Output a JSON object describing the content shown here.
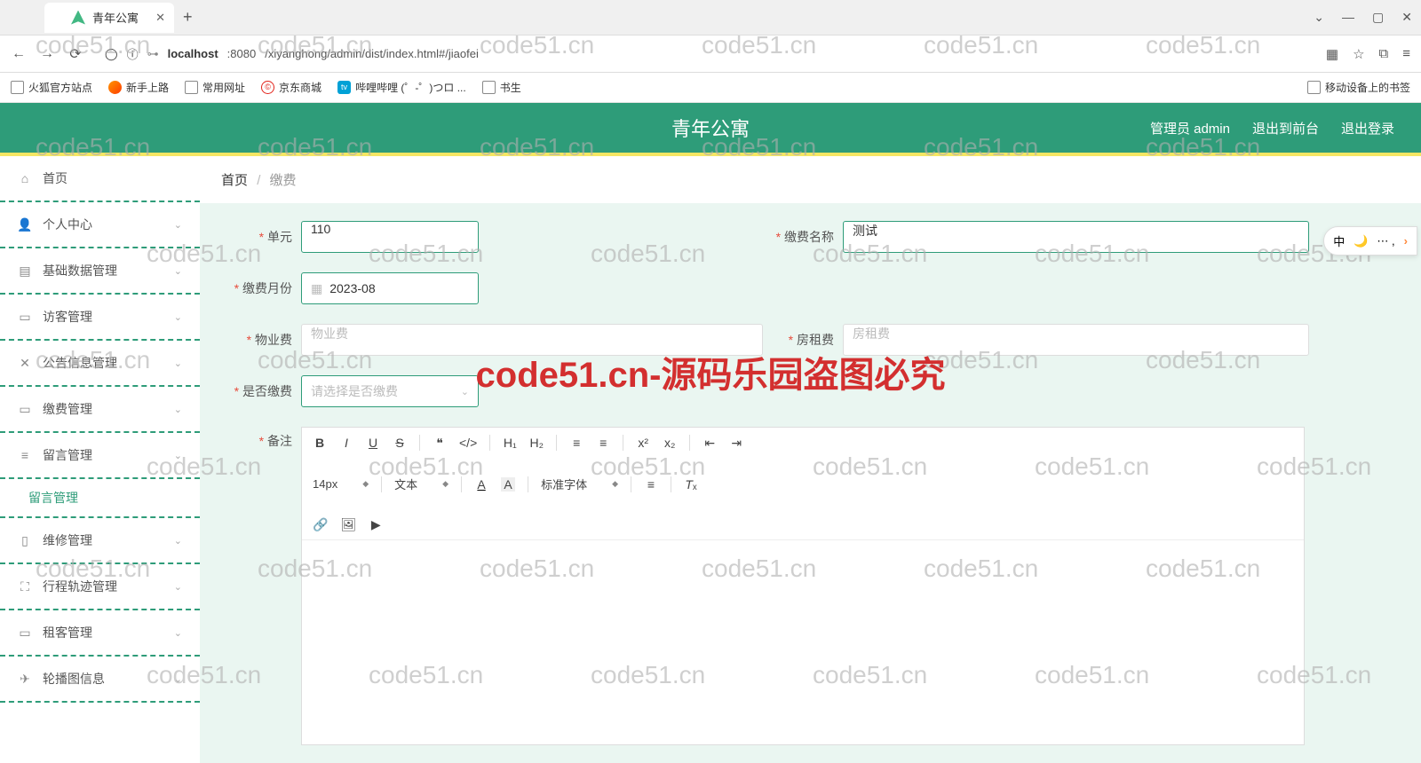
{
  "browser": {
    "tab_title": "青年公寓",
    "url_host": "localhost",
    "url_port": ":8080",
    "url_path": "/xiyanghong/admin/dist/index.html#/jiaofei",
    "bookmarks": [
      "火狐官方站点",
      "新手上路",
      "常用网址",
      "京东商城",
      "哔哩哔哩 (゜-゜)つロ ...",
      "书生"
    ],
    "mobile_bm": "移动设备上的书签"
  },
  "header": {
    "title": "青年公寓",
    "admin_label": "管理员 admin",
    "exit_front": "退出到前台",
    "logout": "退出登录"
  },
  "sidebar": {
    "items": [
      "首页",
      "个人中心",
      "基础数据管理",
      "访客管理",
      "公告信息管理",
      "缴费管理",
      "留言管理",
      "维修管理",
      "行程轨迹管理",
      "租客管理",
      "轮播图信息"
    ],
    "sub": "留言管理"
  },
  "breadcrumb": {
    "home": "首页",
    "current": "缴费"
  },
  "form": {
    "unit_label": "单元",
    "unit_value": "110",
    "name_label": "缴费名称",
    "name_value": "测试",
    "month_label": "缴费月份",
    "month_value": "2023-08",
    "property_label": "物业费",
    "property_ph": "物业费",
    "rent_label": "房租费",
    "rent_ph": "房租费",
    "paid_label": "是否缴费",
    "paid_ph": "请选择是否缴费",
    "remark_label": "备注"
  },
  "editor": {
    "fontsize": "14px",
    "text": "文本",
    "standard_font": "标准字体"
  },
  "watermark": "code51.cn",
  "big_watermark": "code51.cn-源码乐园盗图必究",
  "ime": "中"
}
